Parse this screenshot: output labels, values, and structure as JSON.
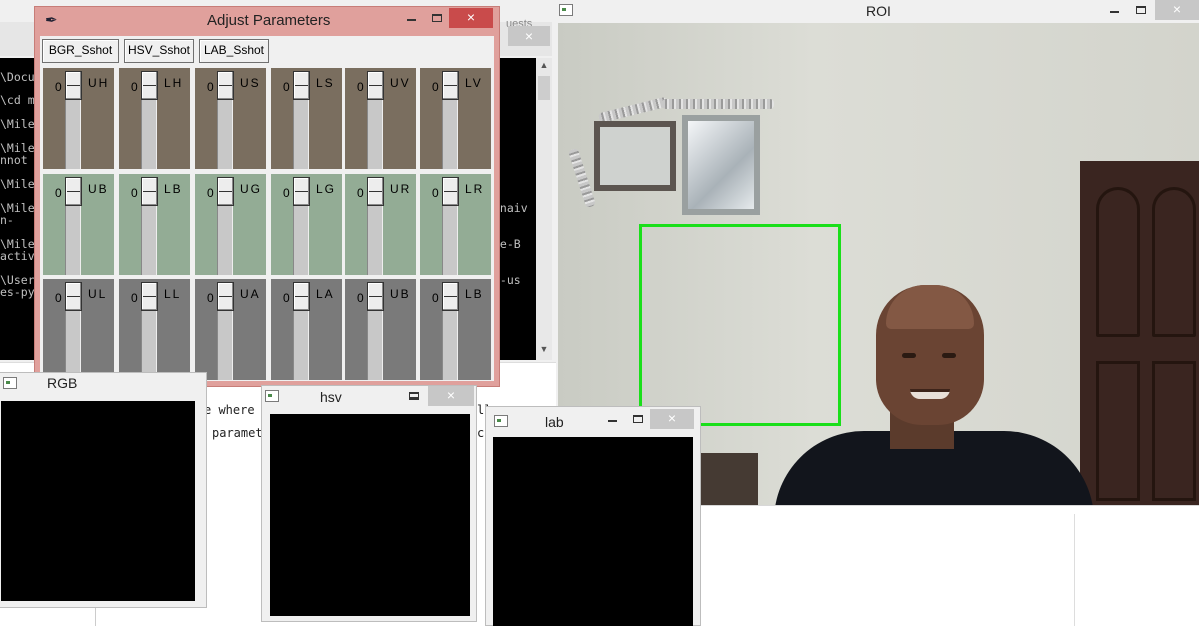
{
  "console": {
    "lines": [
      "\\Docu",
      "\\cd m",
      "\\Mile",
      "\\Mile",
      "nnot",
      "\\Mile",
      "\\Mile",
      "n-",
      "\\Mile",
      "activ",
      "\\User",
      "es-py"
    ],
    "right_lines": [
      "enaiv",
      "ve-B",
      "n-us"
    ],
    "top_right_label": "uests"
  },
  "document": {
    "frag1": "e where",
    "frag2": "paramet",
    "frag3": "ck",
    "frag4": "ll"
  },
  "roi": {
    "title": "ROI"
  },
  "adjust": {
    "title": "Adjust Parameters",
    "buttons": [
      "BGR_Sshot",
      "HSV_Sshot",
      "LAB_Sshot"
    ],
    "sliders": [
      {
        "label": "UH",
        "value": "0"
      },
      {
        "label": "LH",
        "value": "0"
      },
      {
        "label": "US",
        "value": "0"
      },
      {
        "label": "LS",
        "value": "0"
      },
      {
        "label": "UV",
        "value": "0"
      },
      {
        "label": "LV",
        "value": "0"
      },
      {
        "label": "UB",
        "value": "0"
      },
      {
        "label": "LB",
        "value": "0"
      },
      {
        "label": "UG",
        "value": "0"
      },
      {
        "label": "LG",
        "value": "0"
      },
      {
        "label": "UR",
        "value": "0"
      },
      {
        "label": "LR",
        "value": "0"
      },
      {
        "label": "UL",
        "value": "0"
      },
      {
        "label": "LL",
        "value": "0"
      },
      {
        "label": "UA",
        "value": "0"
      },
      {
        "label": "LA",
        "value": "0"
      },
      {
        "label": "UB",
        "value": "0"
      },
      {
        "label": "LB",
        "value": "0"
      }
    ],
    "row_colors": [
      "#7a6e5f",
      "#93ac95",
      "#7a7a7a"
    ]
  },
  "rgb": {
    "title": "RGB"
  },
  "hsv": {
    "title": "hsv"
  },
  "lab": {
    "title": "lab"
  },
  "icons": {
    "close": "×",
    "feather": "feather-icon"
  }
}
